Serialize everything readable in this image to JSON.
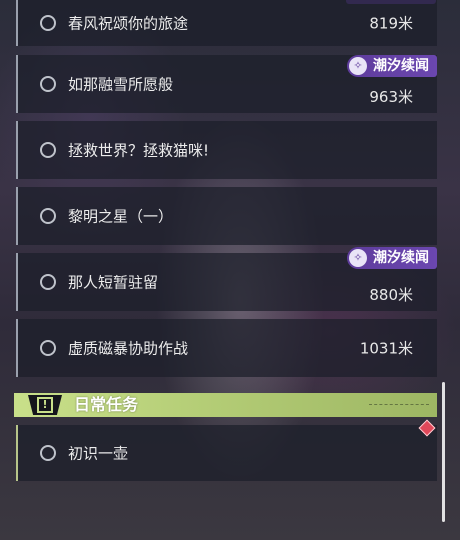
{
  "quests": [
    {
      "title": "春风祝颂你的旅途",
      "distance": "819米"
    },
    {
      "title": "如那融雪所愿般",
      "distance": "963米",
      "tag": "潮汐续闻"
    },
    {
      "title": "拯救世界？拯救猫咪!"
    },
    {
      "title": "黎明之星（一）"
    },
    {
      "title": "那人短暂驻留",
      "distance": "880米",
      "tag": "潮汐续闻"
    },
    {
      "title": "虚质磁暴协助作战",
      "distance": "1031米"
    }
  ],
  "daily_section": {
    "title": "日常任务",
    "quests": [
      {
        "title": "初识一壶"
      }
    ]
  },
  "colors": {
    "daily_accent": "#c9e08a",
    "tag_purple": "#6b47b0",
    "marker_red": "#e0485a"
  }
}
